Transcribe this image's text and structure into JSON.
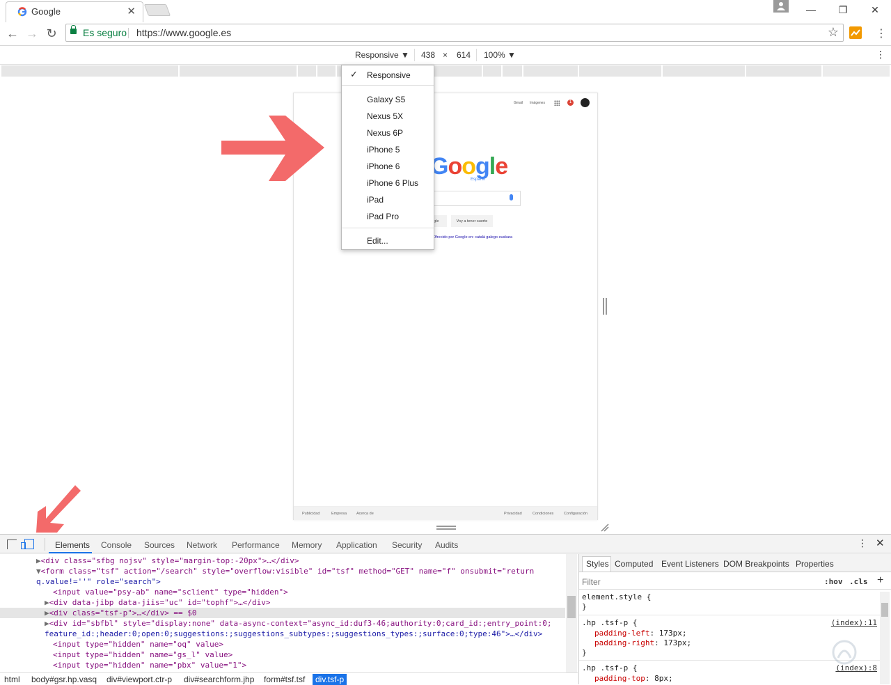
{
  "browser": {
    "tab_title": "Google",
    "tab_close": "✕",
    "window_controls": [
      "—",
      "❐",
      "✕"
    ],
    "nav": {
      "back": "←",
      "forward": "→",
      "reload": "↻"
    },
    "omnibox": {
      "secure_label": "Es seguro",
      "url": "https://www.google.es"
    },
    "star": "☆",
    "menu": "⋮"
  },
  "device_toolbar": {
    "mode": "Responsive ▼",
    "width": "438",
    "times": "×",
    "height": "614",
    "zoom": "100% ▼",
    "menu": "⋮"
  },
  "device_dropdown": {
    "selected": "Responsive",
    "check": "✓",
    "options": [
      "Galaxy S5",
      "Nexus 5X",
      "Nexus 6P",
      "iPhone 5",
      "iPhone 6",
      "iPhone 6 Plus",
      "iPad",
      "iPad Pro"
    ],
    "edit": "Edit..."
  },
  "google_page": {
    "top_links": [
      "Gmail",
      "Imágenes"
    ],
    "notif_count": "1",
    "logo_letters": [
      "G",
      "o",
      "o",
      "g",
      "l",
      "e"
    ],
    "logo_colors": [
      "#4285f4",
      "#ea4335",
      "#fbbc05",
      "#4285f4",
      "#34a853",
      "#ea4335"
    ],
    "logo_sub": "España",
    "buttons": [
      "Buscar con Google",
      "Voy a tener suerte"
    ],
    "languages": "Ofrecido por Google en: català galego euskara",
    "footer_left": [
      "Publicidad",
      "Empresa",
      "Acerca de"
    ],
    "footer_right": [
      "Privacidad",
      "Condiciones",
      "Configuración"
    ]
  },
  "devtools": {
    "tabs": [
      "Elements",
      "Console",
      "Sources",
      "Network",
      "Performance",
      "Memory",
      "Application",
      "Security",
      "Audits"
    ],
    "active_tab": "Elements",
    "menu": "⋮",
    "close": "✕",
    "dom_lines": [
      {
        "indent": 52,
        "tri": "▶",
        "html": "<div class=\"sfbg nojsv\" style=\"margin-top:-20px\">…</div>"
      },
      {
        "indent": 52,
        "tri": "▼",
        "html": "<form class=\"tsf\" action=\"/search\" style=\"overflow:visible\" id=\"tsf\" method=\"GET\" name=\"f\" onsubmit=\"return"
      },
      {
        "indent": 52,
        "tri": "",
        "html": "q.value!=''\" role=\"search\">"
      },
      {
        "indent": 64,
        "tri": "",
        "html": "<input value=\"psy-ab\" name=\"sclient\" type=\"hidden\">"
      },
      {
        "indent": 64,
        "tri": "▶",
        "html": "<div data-jibp data-jiis=\"uc\" id=\"tophf\">…</div>"
      },
      {
        "indent": 64,
        "tri": "▶",
        "html": "<div class=\"tsf-p\">…</div> == $0"
      },
      {
        "indent": 64,
        "tri": "▶",
        "html": "<div id=\"sbfbl\" style=\"display:none\" data-async-context=\"async_id:duf3-46;authority:0;card_id:;entry_point:0;"
      },
      {
        "indent": 64,
        "tri": "",
        "html": "feature_id:;header:0;open:0;suggestions:;suggestions_subtypes:;suggestions_types:;surface:0;type:46\">…</div>"
      },
      {
        "indent": 64,
        "tri": "",
        "html": "<input type=\"hidden\" name=\"oq\" value>"
      },
      {
        "indent": 64,
        "tri": "",
        "html": "<input type=\"hidden\" name=\"gs_l\" value>"
      },
      {
        "indent": 64,
        "tri": "",
        "html": "<input type=\"hidden\" name=\"pbx\" value=\"1\">"
      }
    ],
    "breadcrumbs": [
      "html",
      "body#gsr.hp.vasq",
      "div#viewport.ctr-p",
      "div#searchform.jhp",
      "form#tsf.tsf",
      "div.tsf-p"
    ],
    "styles_tabs": [
      "Styles",
      "Computed",
      "Event Listeners",
      "DOM Breakpoints",
      "Properties"
    ],
    "filter": {
      "label": "Filter",
      "hov": ":hov",
      "cls": ".cls",
      "plus": "+"
    },
    "rules": {
      "element_style": "element.style {",
      "close": "}",
      "r1_selector": ".hp .tsf-p {",
      "r1_source": "(index):11",
      "r1_p1": "padding-left",
      "r1_v1": "173px;",
      "r1_p2": "padding-right",
      "r1_v2": "173px;",
      "r2_selector": ".hp .tsf-p {",
      "r2_source": "(index):8",
      "r2_p1": "padding-top",
      "r2_v1": "8px;"
    }
  },
  "annotation_color": "#f05a5a"
}
